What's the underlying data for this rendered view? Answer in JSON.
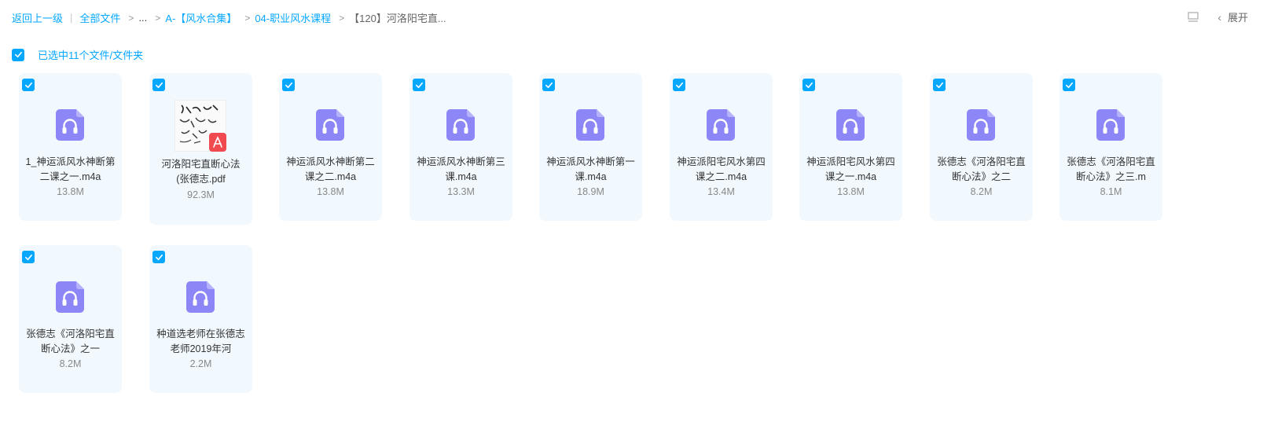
{
  "breadcrumb": {
    "back": "返回上一级",
    "all_files": "全部文件",
    "ellipsis": "...",
    "folder1": "A-【风水合集】",
    "folder2": "04-职业风水课程",
    "current": "【120】河洛阳宅直..."
  },
  "top_right": {
    "expand_label": "展开"
  },
  "selection": {
    "text": "已选中11个文件/文件夹"
  },
  "files": [
    {
      "name": "1_神运派风水神断第二课之一.m4a",
      "size": "13.8M",
      "type": "audio"
    },
    {
      "name": "河洛阳宅直断心法(张德志.pdf",
      "size": "92.3M",
      "type": "pdf"
    },
    {
      "name": "神运派风水神断第二课之二.m4a",
      "size": "13.8M",
      "type": "audio"
    },
    {
      "name": "神运派风水神断第三课.m4a",
      "size": "13.3M",
      "type": "audio"
    },
    {
      "name": "神运派风水神断第一课.m4a",
      "size": "18.9M",
      "type": "audio"
    },
    {
      "name": "神运派阳宅风水第四课之二.m4a",
      "size": "13.4M",
      "type": "audio"
    },
    {
      "name": "神运派阳宅风水第四课之一.m4a",
      "size": "13.8M",
      "type": "audio"
    },
    {
      "name": "张德志《河洛阳宅直断心法》之二",
      "size": "8.2M",
      "type": "audio"
    },
    {
      "name": "张德志《河洛阳宅直断心法》之三.m",
      "size": "8.1M",
      "type": "audio"
    },
    {
      "name": "张德志《河洛阳宅直断心法》之一",
      "size": "8.2M",
      "type": "audio"
    },
    {
      "name": "种道选老师在张德志老师2019年河",
      "size": "2.2M",
      "type": "audio"
    }
  ],
  "colors": {
    "accent": "#06a7ff",
    "card_bg": "#f2f9fe",
    "audio_icon": "#8c86f6"
  }
}
